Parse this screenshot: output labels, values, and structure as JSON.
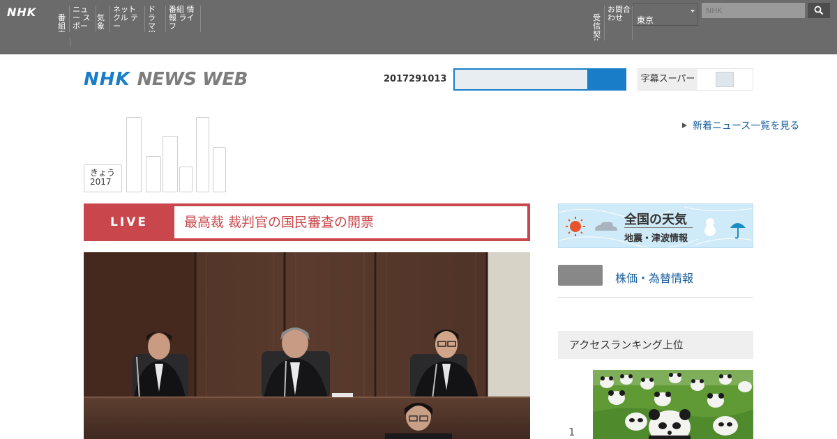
{
  "global_nav": {
    "logo": "NHK",
    "items": [
      {
        "label": "番組 表"
      },
      {
        "label": "ニュー スポー"
      },
      {
        "label": "気象"
      },
      {
        "label": "ネットクル テー"
      },
      {
        "label": "ドラマ 組表"
      },
      {
        "label": "番組 情報 ライフ"
      }
    ],
    "right_items": [
      {
        "label": "受信 契約"
      },
      {
        "label": "お問合 わせ"
      }
    ],
    "region_label": "東京",
    "search_placeholder": "NHK"
  },
  "header": {
    "logo_nhk": "NHK",
    "logo_news": "NEWS WEB",
    "date_code": "2017291013",
    "toggle_label": "字幕スーパー"
  },
  "graph": {
    "date_line1": "きょう",
    "date_line2": "2017",
    "bars": [
      {
        "level": 1.0
      },
      {
        "level": 0.48
      },
      {
        "level": 0.75
      },
      {
        "level": 0.34
      },
      {
        "level": 1.0
      },
      {
        "level": 0.6
      }
    ]
  },
  "latest_link": "新着ニュース一覧を見る",
  "live": {
    "tag": "LIVE",
    "title": "最高裁 裁判官の国民審査の開票"
  },
  "weather_banner": {
    "line1": "全国の天気",
    "line2": "地震・津波情報"
  },
  "stock": {
    "link": "株価・為替情報"
  },
  "ranking": {
    "heading": "アクセスランキング上位",
    "items": [
      {
        "rank": "1"
      }
    ]
  },
  "colors": {
    "topbar": "#6b6b6b",
    "nhk_blue": "#1a7dc8",
    "live_red": "#c9474c",
    "link_blue": "#1a5f9e"
  }
}
